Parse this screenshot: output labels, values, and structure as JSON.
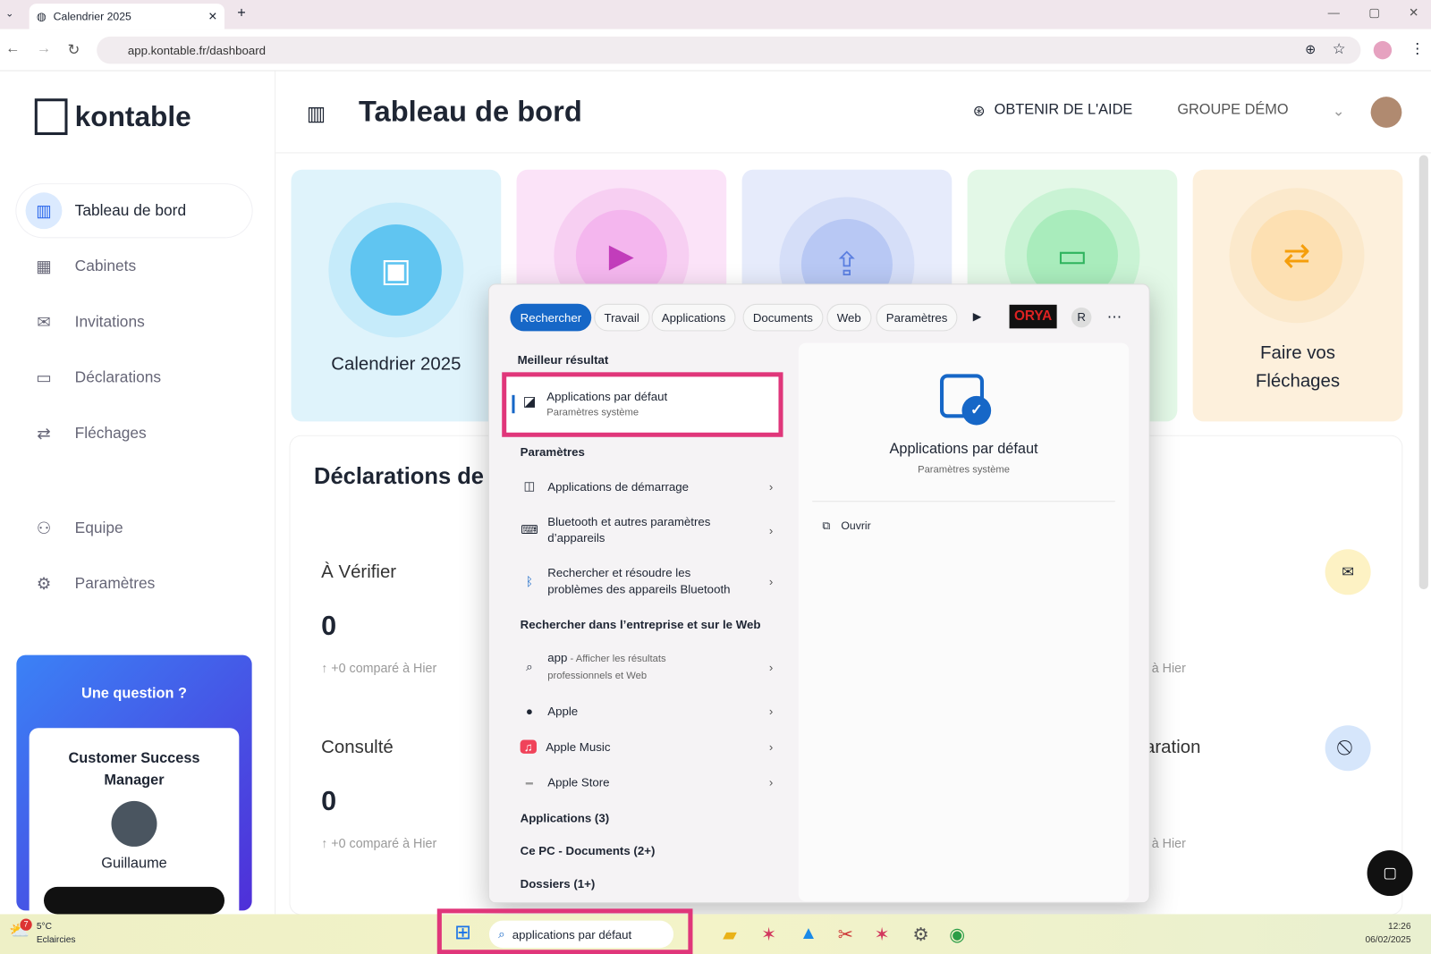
{
  "browser": {
    "tab_title": "Calendrier 2025",
    "url": "app.kontable.fr/dashboard"
  },
  "sidebar": {
    "logo": "kontable",
    "items": [
      {
        "label": "Tableau de bord",
        "icon": "bar-chart-icon"
      },
      {
        "label": "Cabinets",
        "icon": "building-icon"
      },
      {
        "label": "Invitations",
        "icon": "mail-icon"
      },
      {
        "label": "Déclarations",
        "icon": "folder-icon"
      },
      {
        "label": "Fléchages",
        "icon": "arrows-icon"
      },
      {
        "label": "Equipe",
        "icon": "team-icon"
      },
      {
        "label": "Paramètres",
        "icon": "gear-icon"
      }
    ],
    "help": {
      "title": "Une question ?",
      "role": "Customer Success Manager",
      "name": "Guillaume"
    }
  },
  "header": {
    "title": "Tableau de bord",
    "help": "OBTENIR DE L'AIDE",
    "group": "GROUPE DÉMO"
  },
  "cards": [
    {
      "label": "Calendrier 2025",
      "color": "#60c5f1"
    },
    {
      "label": "",
      "color": "#e07ad8"
    },
    {
      "label": "",
      "color": "#8aa8ee"
    },
    {
      "label": "",
      "color": "#5fd58a"
    },
    {
      "label": "Faire vos Fléchages",
      "color": "#f7b955"
    }
  ],
  "panel": {
    "title": "Déclarations de",
    "stats": [
      {
        "label": "À Vérifier",
        "value": "0",
        "delta": "+0 comparé à Hier"
      },
      {
        "label": "Consulté",
        "value": "0",
        "delta": "+0 comparé à Hier"
      }
    ],
    "right_label": "laration",
    "right_delta": "à Hier"
  },
  "search": {
    "tabs": [
      "Rechercher",
      "Travail",
      "Applications",
      "Documents",
      "Web",
      "Paramètres"
    ],
    "orya": "ORYA",
    "user_initial": "R",
    "best_heading": "Meilleur résultat",
    "best": {
      "title": "Applications par défaut",
      "sub": "Paramètres système"
    },
    "settings_heading": "Paramètres",
    "settings": [
      "Applications de démarrage",
      "Bluetooth et autres paramètres d’appareils",
      "Rechercher et résoudre les problèmes des appareils Bluetooth"
    ],
    "web_heading": "Rechercher dans l’entreprise et sur le Web",
    "web": [
      {
        "title": "app",
        "sub": " - Afficher les résultats professionnels et Web"
      },
      {
        "title": "Apple"
      },
      {
        "title": "Apple Music"
      },
      {
        "title": "Apple Store"
      }
    ],
    "groups": [
      "Applications (3)",
      "Ce PC - Documents (2+)",
      "Dossiers (1+)"
    ],
    "preview": {
      "title": "Applications par défaut",
      "sub": "Paramètres système",
      "open": "Ouvrir"
    }
  },
  "taskbar": {
    "weather_temp": "5°C",
    "weather_desc": "Eclaircies",
    "weather_badge": "7",
    "search_value": "applications par défaut",
    "time": "12:26",
    "date": "06/02/2025"
  }
}
